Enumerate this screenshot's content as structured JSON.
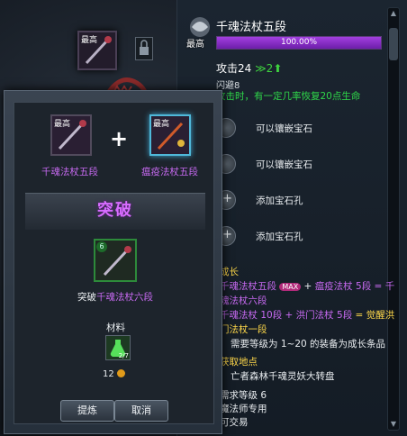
{
  "item": {
    "rarity_badge": "最高",
    "name": "千魂法杖五段",
    "progress_text": "100.00%",
    "progress_fraction": 1.0,
    "attack_label": "攻击24",
    "attack_bonus": "2",
    "dodge": "闪避8",
    "effect_text": "攻击时，有一定几率恢复20点生命"
  },
  "sockets": [
    {
      "label": "可以镶嵌宝石",
      "icon": "empty-socket-icon"
    },
    {
      "label": "可以镶嵌宝石",
      "icon": "empty-socket-icon"
    },
    {
      "label": "添加宝石孔",
      "icon": "add-socket-icon"
    },
    {
      "label": "添加宝石孔",
      "icon": "add-socket-icon"
    }
  ],
  "growth": {
    "section_title": "成长",
    "line1_a": "千魂法杖五段",
    "line1_max": "MAX",
    "line1_plus": " + ",
    "line1_b": "瘟疫法杖 5段",
    "line1_eq": " = 千",
    "line2": "魂法杖六段",
    "line3_a": "千魂法杖 10段",
    "line3_plus": " + 洪门法杖 5段",
    "line3_eq": " = 觉醒洪",
    "line4": "门法杖一段",
    "line5": "需要等级为 1~20 的装备为成长条品"
  },
  "source": {
    "section_title": "获取地点",
    "line1": "亡者森林千魂灵妖大转盘",
    "req_level": "需求等级 6",
    "profession": "魔法师专用",
    "tradeable": "可交易"
  },
  "dialog": {
    "slot_badge": "最高",
    "ingredient1": "千魂法杖五段",
    "ingredient2": "瘟疫法杖五段",
    "plus": "+",
    "break_title": "突破",
    "result_level": "6",
    "result_prefix": "突破",
    "result_name": "千魂法杖六段",
    "material_title": "材料",
    "material_count": "2/7",
    "gold": "12",
    "btn_refine": "提炼",
    "btn_cancel": "取消"
  },
  "colors": {
    "purple_name": "#c86af2",
    "effect_green": "#2fd84a",
    "section_yellow": "#ffd84a",
    "progress_purple": "#a23fe0"
  }
}
